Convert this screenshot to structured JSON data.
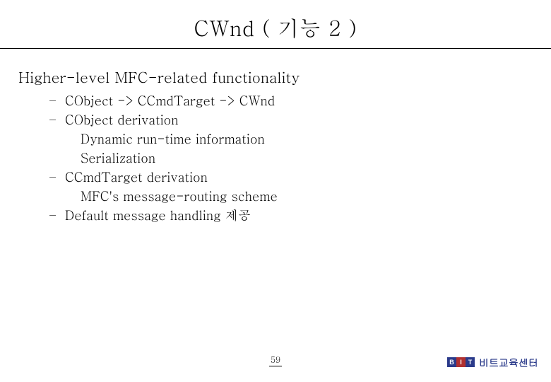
{
  "title": "CWnd ( 기능 2 )",
  "heading": "Higher-level MFC-related functionality",
  "bullets": [
    {
      "mark": "–",
      "text": "CObject -> CCmdTarget -> CWnd",
      "sub": []
    },
    {
      "mark": "–",
      "text": "CObject derivation",
      "sub": [
        "Dynamic run-time information",
        "Serialization"
      ]
    },
    {
      "mark": "–",
      "text": "CCmdTarget derivation",
      "sub": [
        "MFC's message-routing scheme"
      ]
    },
    {
      "mark": "–",
      "text": "Default message handling 제공",
      "sub": []
    }
  ],
  "page_number": "59",
  "brand": {
    "b": "B",
    "i": "I",
    "t": "T",
    "text": "비트교육센터"
  }
}
